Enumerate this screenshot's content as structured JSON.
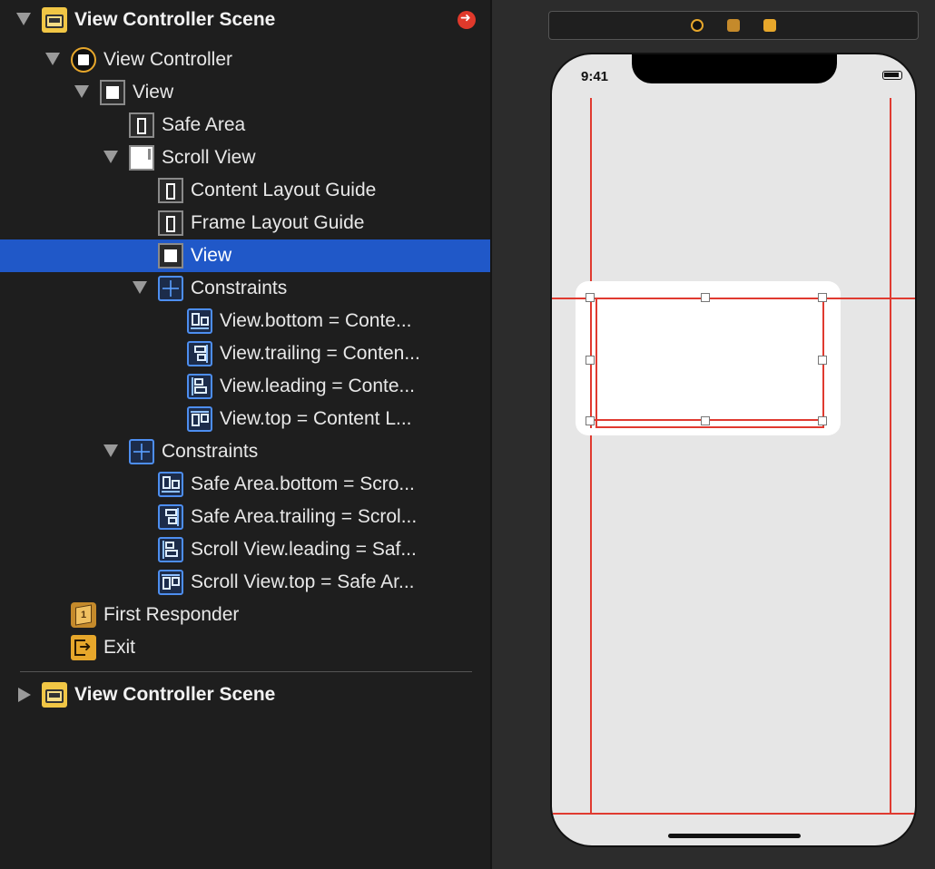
{
  "outline": {
    "scene1_title": "View Controller Scene",
    "view_controller": "View Controller",
    "view": "View",
    "safe_area": "Safe Area",
    "scroll_view": "Scroll View",
    "content_layout_guide": "Content Layout Guide",
    "frame_layout_guide": "Frame Layout Guide",
    "inner_view": "View",
    "inner_constraints": "Constraints",
    "inner_c1": "View.bottom = Conte...",
    "inner_c2": "View.trailing = Conten...",
    "inner_c3": "View.leading = Conte...",
    "inner_c4": "View.top = Content L...",
    "outer_constraints": "Constraints",
    "outer_c1": "Safe Area.bottom = Scro...",
    "outer_c2": "Safe Area.trailing = Scrol...",
    "outer_c3": "Scroll View.leading = Saf...",
    "outer_c4": "Scroll View.top = Safe Ar...",
    "first_responder": "First Responder",
    "exit": "Exit",
    "scene2_title": "View Controller Scene"
  },
  "canvas": {
    "status_time": "9:41"
  },
  "colors": {
    "selection": "#2058c8",
    "constraint_red": "#e03a30",
    "warning": "#e0392b"
  },
  "icons": [
    "scene-icon",
    "view-controller-icon",
    "view-icon",
    "safe-area-icon",
    "scroll-view-icon",
    "layout-guide-icon",
    "constraints-icon",
    "first-responder-icon",
    "exit-icon",
    "warning-arrow-icon"
  ]
}
